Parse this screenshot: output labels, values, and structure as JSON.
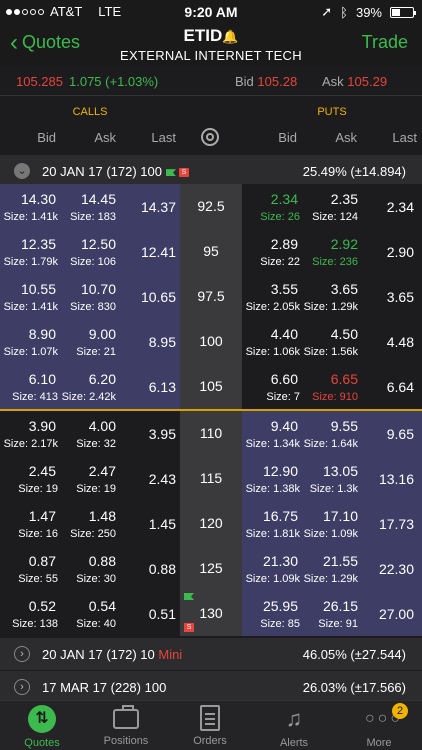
{
  "status": {
    "carrier": "AT&T",
    "network": "LTE",
    "time": "9:20 AM",
    "battery": "39%",
    "battery_level": 0.39
  },
  "nav": {
    "back_label": "Quotes",
    "symbol": "ETID",
    "company": "EXTERNAL INTERNET TECH",
    "trade_label": "Trade"
  },
  "quote": {
    "last": "105.285",
    "change": "1.075 (+1.03%)",
    "bid_label": "Bid",
    "bid": "105.28",
    "ask_label": "Ask",
    "ask": "105.29"
  },
  "headers": {
    "calls": "CALLS",
    "puts": "PUTS",
    "bid": "Bid",
    "ask": "Ask",
    "last": "Last"
  },
  "expiries": [
    {
      "label": "20 JAN 17 (172) 100",
      "mini": "",
      "iv": "25.49% (±14.894)",
      "expanded": true
    },
    {
      "label": "20 JAN 17 (172) 10",
      "mini": "Mini",
      "iv": "46.05% (±27.544)",
      "expanded": false
    },
    {
      "label": "17 MAR 17 (228) 100",
      "mini": "",
      "iv": "26.03% (±17.566)",
      "expanded": false
    }
  ],
  "chain": [
    {
      "strike": "92.5",
      "call_itm": true,
      "put_itm": false,
      "call": {
        "bid": "14.30",
        "bid_size": "Size: 1.41k",
        "ask": "14.45",
        "ask_size": "Size: 183",
        "last": "14.37"
      },
      "put": {
        "bid": "2.34",
        "bid_size": "Size: 26",
        "ask": "2.35",
        "ask_size": "Size: 124",
        "last": "2.34",
        "bid_color": "green"
      }
    },
    {
      "strike": "95",
      "call_itm": true,
      "put_itm": false,
      "call": {
        "bid": "12.35",
        "bid_size": "Size: 1.79k",
        "ask": "12.50",
        "ask_size": "Size: 106",
        "last": "12.41"
      },
      "put": {
        "bid": "2.89",
        "bid_size": "Size: 22",
        "ask": "2.92",
        "ask_size": "Size: 236",
        "last": "2.90",
        "ask_color": "green"
      }
    },
    {
      "strike": "97.5",
      "call_itm": true,
      "put_itm": false,
      "call": {
        "bid": "10.55",
        "bid_size": "Size: 1.41k",
        "ask": "10.70",
        "ask_size": "Size: 830",
        "last": "10.65"
      },
      "put": {
        "bid": "3.55",
        "bid_size": "Size: 2.05k",
        "ask": "3.65",
        "ask_size": "Size: 1.29k",
        "last": "3.65"
      }
    },
    {
      "strike": "100",
      "call_itm": true,
      "put_itm": false,
      "call": {
        "bid": "8.90",
        "bid_size": "Size: 1.07k",
        "ask": "9.00",
        "ask_size": "Size: 21",
        "last": "8.95"
      },
      "put": {
        "bid": "4.40",
        "bid_size": "Size: 1.06k",
        "ask": "4.50",
        "ask_size": "Size: 1.56k",
        "last": "4.48"
      }
    },
    {
      "strike": "105",
      "call_itm": true,
      "put_itm": false,
      "call": {
        "bid": "6.10",
        "bid_size": "Size: 413",
        "ask": "6.20",
        "ask_size": "Size: 2.42k",
        "last": "6.13"
      },
      "put": {
        "bid": "6.60",
        "bid_size": "Size: 7",
        "ask": "6.65",
        "ask_size": "Size: 910",
        "last": "6.64",
        "ask_color": "red"
      }
    },
    {
      "strike": "110",
      "call_itm": false,
      "put_itm": true,
      "call": {
        "bid": "3.90",
        "bid_size": "Size: 2.17k",
        "ask": "4.00",
        "ask_size": "Size: 32",
        "last": "3.95"
      },
      "put": {
        "bid": "9.40",
        "bid_size": "Size: 1.34k",
        "ask": "9.55",
        "ask_size": "Size: 1.64k",
        "last": "9.65"
      }
    },
    {
      "strike": "115",
      "call_itm": false,
      "put_itm": true,
      "call": {
        "bid": "2.45",
        "bid_size": "Size: 19",
        "ask": "2.47",
        "ask_size": "Size: 19",
        "last": "2.43"
      },
      "put": {
        "bid": "12.90",
        "bid_size": "Size: 1.38k",
        "ask": "13.05",
        "ask_size": "Size: 1.3k",
        "last": "13.16"
      }
    },
    {
      "strike": "120",
      "call_itm": false,
      "put_itm": true,
      "call": {
        "bid": "1.47",
        "bid_size": "Size: 16",
        "ask": "1.48",
        "ask_size": "Size: 250",
        "last": "1.45"
      },
      "put": {
        "bid": "16.75",
        "bid_size": "Size: 1.81k",
        "ask": "17.10",
        "ask_size": "Size: 1.09k",
        "last": "17.73"
      }
    },
    {
      "strike": "125",
      "call_itm": false,
      "put_itm": true,
      "call": {
        "bid": "0.87",
        "bid_size": "Size: 55",
        "ask": "0.88",
        "ask_size": "Size: 30",
        "last": "0.88"
      },
      "put": {
        "bid": "21.30",
        "bid_size": "Size: 1.09k",
        "ask": "21.55",
        "ask_size": "Size: 1.29k",
        "last": "22.30"
      }
    },
    {
      "strike": "130",
      "call_itm": false,
      "put_itm": true,
      "strike_flag": true,
      "call": {
        "bid": "0.52",
        "bid_size": "Size: 138",
        "ask": "0.54",
        "ask_size": "Size: 40",
        "last": "0.51"
      },
      "put": {
        "bid": "25.95",
        "bid_size": "Size: 85",
        "ask": "26.15",
        "ask_size": "Size: 91",
        "last": "27.00"
      }
    }
  ],
  "tabs": [
    {
      "label": "Quotes",
      "icon": "quotes-icon",
      "active": true
    },
    {
      "label": "Positions",
      "icon": "briefcase-icon"
    },
    {
      "label": "Orders",
      "icon": "document-icon"
    },
    {
      "label": "Alerts",
      "icon": "bell-icon"
    },
    {
      "label": "More",
      "icon": "more-icon",
      "badge": "2"
    }
  ],
  "colors": {
    "green": "#3dba4e",
    "red": "#e8443a",
    "gold": "#f0b400",
    "itm": "#3d3d65"
  }
}
